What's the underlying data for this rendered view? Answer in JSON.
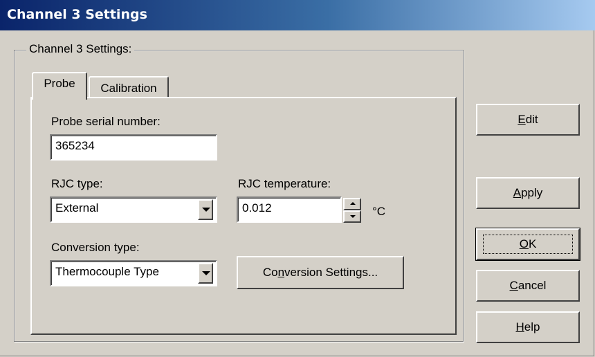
{
  "window": {
    "title": "Channel 3 Settings"
  },
  "groupbox": {
    "label": "Channel 3 Settings:"
  },
  "tabs": [
    {
      "label": "Probe",
      "active": true
    },
    {
      "label": "Calibration",
      "active": false
    }
  ],
  "probe": {
    "serial_label": "Probe serial number:",
    "serial_value": "365234",
    "rjc_type_label": "RJC type:",
    "rjc_type_value": "External",
    "rjc_temp_label": "RJC temperature:",
    "rjc_temp_value": "0.012",
    "rjc_temp_unit": "°C",
    "conversion_label": "Conversion type:",
    "conversion_value": "Thermocouple Type",
    "conversion_settings": {
      "prefix": "Co",
      "mnemonic": "n",
      "suffix": "version Settings..."
    }
  },
  "buttons": {
    "edit": {
      "mnemonic": "E",
      "rest": "dit"
    },
    "apply": {
      "mnemonic": "A",
      "rest": "pply"
    },
    "ok": {
      "mnemonic": "O",
      "rest": "K"
    },
    "cancel": {
      "mnemonic": "C",
      "rest": "ancel"
    },
    "help": {
      "mnemonic": "H",
      "rest": "elp"
    }
  },
  "colors": {
    "face": "#d4d0c8",
    "title_start": "#0a246a",
    "title_end": "#a6caf0"
  }
}
